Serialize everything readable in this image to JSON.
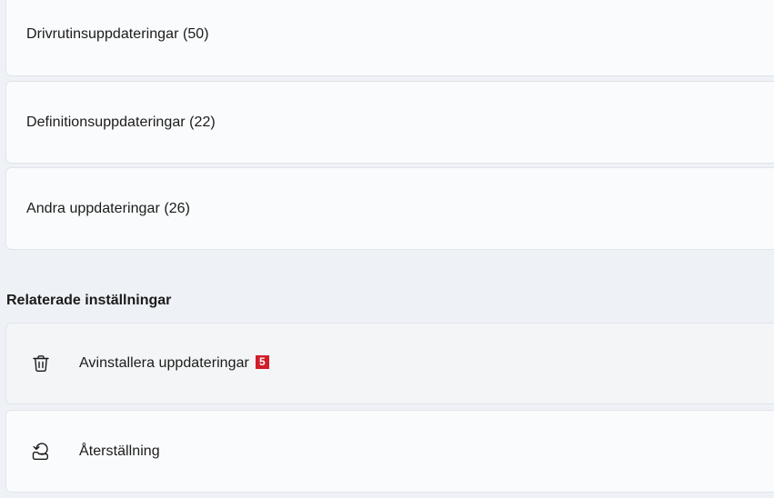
{
  "update_categories": [
    {
      "label": "Drivrutinsuppdateringar (50)"
    },
    {
      "label": "Definitionsuppdateringar (22)"
    },
    {
      "label": "Andra uppdateringar (26)"
    }
  ],
  "related_settings": {
    "heading": "Relaterade inställningar",
    "items": [
      {
        "label": "Avinstallera uppdateringar",
        "icon": "trash-icon",
        "badge": "5"
      },
      {
        "label": "Återställning",
        "icon": "recovery-icon"
      }
    ]
  },
  "colors": {
    "page_background": "#eef2f6",
    "card_background": "#fafbfc",
    "badge_red": "#d11d2a"
  }
}
